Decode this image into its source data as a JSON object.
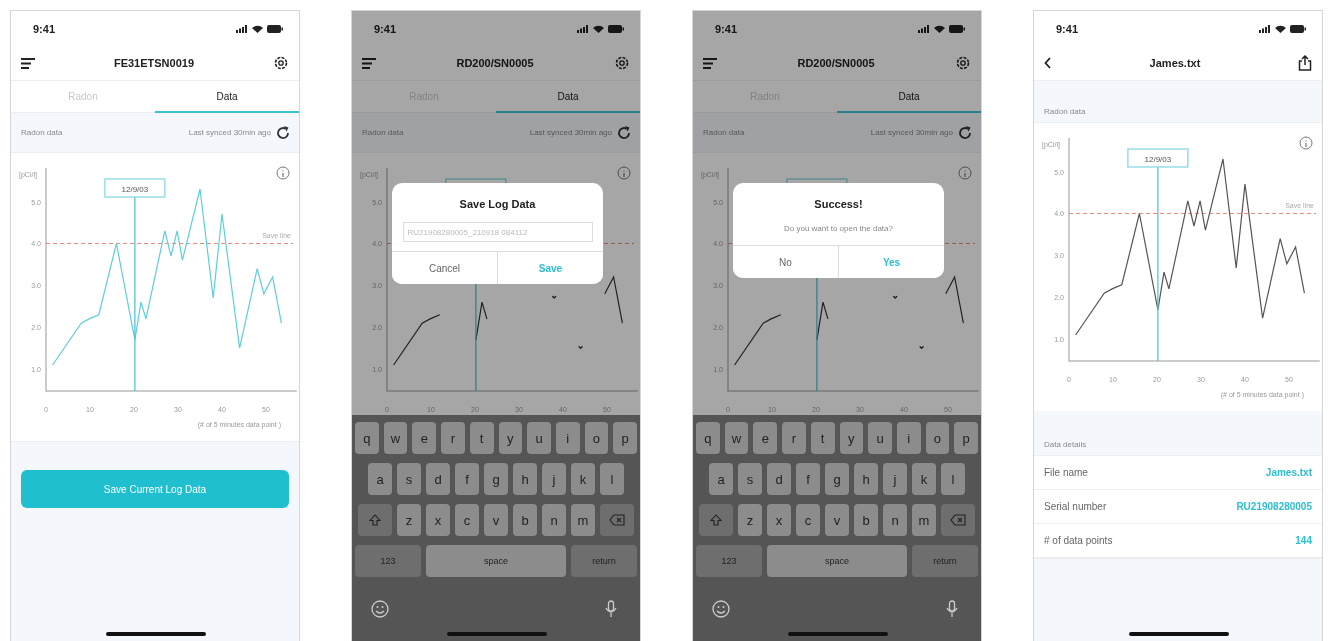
{
  "screens": [
    {
      "kind": "device",
      "status_time": "9:41",
      "title": "FE31ETSN0019",
      "tabs": [
        {
          "label": "Radon",
          "selected": false
        },
        {
          "label": "Data",
          "selected": true
        }
      ],
      "section": {
        "label": "Radon data",
        "synced": "Last synced 30min ago"
      },
      "chart_data": {
        "type": "line",
        "ylabel": "[pCi/l]",
        "xlabel": "(# of 5 minutes data point )",
        "x": [
          1.5,
          8,
          9.8,
          12,
          16,
          20.2,
          21.6,
          22.7,
          27,
          28.4,
          29.8,
          31,
          35,
          38,
          40,
          44,
          48,
          49.5,
          51.5,
          53.5
        ],
        "series": [
          {
            "color": "#5ccfdc",
            "values": [
              1.1,
              2.1,
              2.2,
              2.3,
              4.0,
              1.7,
              2.6,
              2.2,
              4.3,
              3.7,
              4.3,
              3.6,
              5.3,
              2.7,
              4.7,
              1.5,
              3.4,
              2.8,
              3.2,
              2.1
            ]
          }
        ],
        "xlim": [
          0,
          57
        ],
        "ylim": [
          0.48,
          5.8
        ],
        "xticks": [
          0,
          10,
          20,
          30,
          40,
          50
        ],
        "yticks": [
          {
            "value": 1,
            "label": "1.0"
          },
          {
            "value": 2,
            "label": "2.0"
          },
          {
            "value": 3,
            "label": "3.0"
          },
          {
            "value": 4,
            "label": "4.0"
          },
          {
            "value": 5,
            "label": "5.0"
          }
        ],
        "ref_lines": [
          {
            "axis": "x",
            "value": 20.2,
            "color": "#4fc6d6"
          },
          {
            "axis": "y",
            "value": 4,
            "label": "Save line",
            "color": "#e8857a"
          }
        ]
      },
      "chart_tooltip": "12/9/03",
      "button": "Save Current Log Data"
    },
    {
      "kind": "device_keyboard",
      "status_time": "9:41",
      "title": "RD200/SN0005",
      "tabs": [
        {
          "label": "Radon",
          "selected": false
        },
        {
          "label": "Data",
          "selected": true
        }
      ],
      "section": {
        "label": "Radon data",
        "synced": "Last synced 30min ago"
      },
      "chart_data": {
        "type": "line",
        "ylabel": "[pCi/l]",
        "x": [
          1.5,
          8,
          9.8,
          12,
          16,
          20.2,
          21.6,
          22.7,
          27,
          28.4,
          29.8,
          31,
          35,
          38,
          40,
          44,
          48,
          49.5,
          51.5,
          53.5
        ],
        "series": [
          {
            "color": "#333333",
            "values": [
              1.1,
              2.1,
              2.2,
              2.3,
              null,
              1.7,
              2.6,
              2.2,
              null,
              null,
              null,
              null,
              null,
              2.7,
              null,
              1.5,
              null,
              2.8,
              3.2,
              2.1
            ]
          }
        ],
        "xlim": [
          0,
          57
        ],
        "ylim": [
          0.48,
          5.8
        ],
        "xticks": [
          0,
          10,
          20,
          30,
          40,
          50
        ],
        "yticks": [
          {
            "value": 1,
            "label": "1.0"
          },
          {
            "value": 2,
            "label": "2.0"
          },
          {
            "value": 3,
            "label": "3.0"
          },
          {
            "value": 4,
            "label": "4.0"
          },
          {
            "value": 5,
            "label": "5.0"
          }
        ],
        "ref_lines": [
          {
            "axis": "x",
            "value": 20.2,
            "color": "#4fc6d6"
          },
          {
            "axis": "y",
            "value": 4,
            "color": "#e8857a"
          }
        ]
      },
      "dialog": {
        "kind": "input",
        "title": "Save Log Data",
        "placeholder": "RU21908280005_210918 084112",
        "buttons": [
          {
            "label": "Cancel",
            "primary": false
          },
          {
            "label": "Save",
            "primary": true
          }
        ]
      },
      "keyboard": {
        "letter_rows": [
          [
            "q",
            "w",
            "e",
            "r",
            "t",
            "y",
            "u",
            "i",
            "o",
            "p"
          ],
          [
            "a",
            "s",
            "d",
            "f",
            "g",
            "h",
            "j",
            "k",
            "l"
          ],
          [
            "z",
            "x",
            "c",
            "v",
            "b",
            "n",
            "m"
          ]
        ],
        "number_key": "123",
        "space_key": "space",
        "return_key": "return"
      }
    },
    {
      "kind": "device_keyboard",
      "status_time": "9:41",
      "title": "RD200/SN0005",
      "tabs": [
        {
          "label": "Radon",
          "selected": false
        },
        {
          "label": "Data",
          "selected": true
        }
      ],
      "section": {
        "label": "Radon data",
        "synced": "Last synced 30min ago"
      },
      "chart_data": {
        "type": "line",
        "ylabel": "[pCi/l]",
        "x": [
          1.5,
          8,
          9.8,
          12,
          16,
          20.2,
          21.6,
          22.7,
          27,
          28.4,
          29.8,
          31,
          35,
          38,
          40,
          44,
          48,
          49.5,
          51.5,
          53.5
        ],
        "series": [
          {
            "color": "#333333",
            "values": [
              1.1,
              2.1,
              2.2,
              2.3,
              null,
              1.7,
              2.6,
              2.2,
              null,
              null,
              null,
              null,
              null,
              2.7,
              null,
              1.5,
              null,
              2.8,
              3.2,
              2.1
            ]
          }
        ],
        "xlim": [
          0,
          57
        ],
        "ylim": [
          0.48,
          5.8
        ],
        "xticks": [
          0,
          10,
          20,
          30,
          40,
          50
        ],
        "yticks": [
          {
            "value": 1,
            "label": "1.0"
          },
          {
            "value": 2,
            "label": "2.0"
          },
          {
            "value": 3,
            "label": "3.0"
          },
          {
            "value": 4,
            "label": "4.0"
          },
          {
            "value": 5,
            "label": "5.0"
          }
        ],
        "ref_lines": [
          {
            "axis": "x",
            "value": 20.2,
            "color": "#4fc6d6"
          },
          {
            "axis": "y",
            "value": 4,
            "color": "#e8857a"
          }
        ]
      },
      "dialog": {
        "kind": "message",
        "title": "Success!",
        "message": "Do you want to open the data?",
        "buttons": [
          {
            "label": "No",
            "primary": false
          },
          {
            "label": "Yes",
            "primary": true
          }
        ]
      },
      "keyboard": {
        "letter_rows": [
          [
            "q",
            "w",
            "e",
            "r",
            "t",
            "y",
            "u",
            "i",
            "o",
            "p"
          ],
          [
            "a",
            "s",
            "d",
            "f",
            "g",
            "h",
            "j",
            "k",
            "l"
          ],
          [
            "z",
            "x",
            "c",
            "v",
            "b",
            "n",
            "m"
          ]
        ],
        "number_key": "123",
        "space_key": "space",
        "return_key": "return"
      }
    },
    {
      "kind": "file",
      "status_time": "9:41",
      "title": "James.txt",
      "section": {
        "label": "Radon data"
      },
      "chart_data": {
        "type": "line",
        "ylabel": "[pCi/l]",
        "xlabel": "(# of 5 minutes data point )",
        "x": [
          1.5,
          8,
          9.8,
          12,
          16,
          20.2,
          21.6,
          22.7,
          27,
          28.4,
          29.8,
          31,
          35,
          38,
          40,
          44,
          48,
          49.5,
          51.5,
          53.5
        ],
        "series": [
          {
            "color": "#555555",
            "values": [
              1.1,
              2.1,
              2.2,
              2.3,
              4.0,
              1.7,
              2.6,
              2.2,
              4.3,
              3.7,
              4.3,
              3.6,
              5.3,
              2.7,
              4.7,
              1.5,
              3.4,
              2.8,
              3.2,
              2.1
            ]
          }
        ],
        "xlim": [
          0,
          57
        ],
        "ylim": [
          0.48,
          5.8
        ],
        "xticks": [
          0,
          10,
          20,
          30,
          40,
          50
        ],
        "yticks": [
          {
            "value": 1,
            "label": "1.0"
          },
          {
            "value": 2,
            "label": "2.0"
          },
          {
            "value": 3,
            "label": "3.0"
          },
          {
            "value": 4,
            "label": "4.0"
          },
          {
            "value": 5,
            "label": "5.0"
          }
        ],
        "ref_lines": [
          {
            "axis": "x",
            "value": 20.2,
            "color": "#4fc6d6"
          },
          {
            "axis": "y",
            "value": 4,
            "label": "Save line",
            "color": "#e8857a"
          }
        ]
      },
      "chart_tooltip": "12/9/03",
      "details_label": "Data details",
      "details": [
        {
          "label": "File name",
          "value": "James.txt"
        },
        {
          "label": "Serial number",
          "value": "RU21908280005"
        },
        {
          "label": "# of data points",
          "value": "144"
        }
      ]
    }
  ]
}
